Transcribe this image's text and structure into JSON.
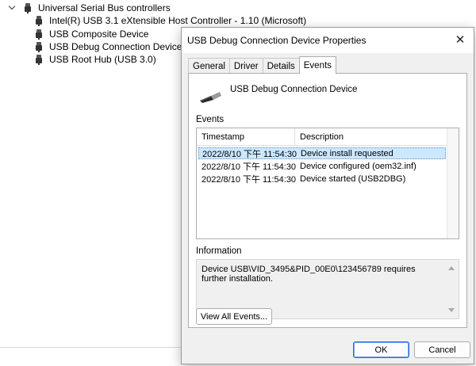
{
  "tree": {
    "category": "Universal Serial Bus controllers",
    "devices": [
      "Intel(R) USB 3.1 eXtensible Host Controller - 1.10 (Microsoft)",
      "USB Composite Device",
      "USB Debug Connection Device",
      "USB Root Hub (USB 3.0)"
    ]
  },
  "dialog": {
    "title": "USB Debug Connection Device Properties",
    "close": "✕",
    "tabs": [
      "General",
      "Driver",
      "Details",
      "Events"
    ],
    "active_tab": "Events",
    "device_name": "USB Debug Connection Device",
    "events_label": "Events",
    "columns": [
      "Timestamp",
      "Description"
    ],
    "events": [
      {
        "timestamp": "2022/8/10 下午 11:54:30",
        "description": "Device install requested"
      },
      {
        "timestamp": "2022/8/10 下午 11:54:30",
        "description": "Device configured (oem32.inf)"
      },
      {
        "timestamp": "2022/8/10 下午 11:54:30",
        "description": "Device started (USB2DBG)"
      }
    ],
    "information_label": "Information",
    "information_text": "Device USB\\VID_3495&PID_00E0\\123456789 requires further installation.",
    "view_all_button": "View All Events...",
    "ok_button": "OK",
    "cancel_button": "Cancel"
  },
  "colors": {
    "selection": "#cce8ff",
    "default_button_border": "#2a6ed4",
    "dialog_bg": "#f0f0f0"
  }
}
